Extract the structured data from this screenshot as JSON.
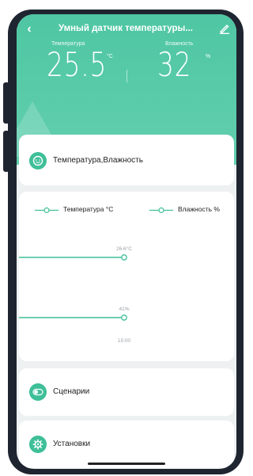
{
  "app": {
    "title": "Умный датчик температуры...",
    "back_icon": "chevron-left-icon",
    "edit_icon": "pencil-icon"
  },
  "readings": {
    "temperature": {
      "label": "Температура",
      "value": "25.5",
      "unit": "°C"
    },
    "humidity": {
      "label": "Влажность",
      "value": "32",
      "unit": "%"
    }
  },
  "cards": {
    "temp_humidity": {
      "label": "Температура,Влажность",
      "icon": "smiley-face-icon"
    },
    "scenarios": {
      "label": "Сценарии",
      "icon": "toggle-icon"
    },
    "settings": {
      "label": "Установки",
      "icon": "gear-icon"
    }
  },
  "colors": {
    "accent": "#3fbf98",
    "header": "#55c8a6",
    "background": "#eef1f2"
  },
  "chart_data": {
    "type": "line",
    "legend": [
      "Температура °C",
      "Влажность %"
    ],
    "legend_placement": "top-left",
    "x": [
      "15:00"
    ],
    "series": [
      {
        "name": "Температура °C",
        "values": [
          26.6
        ],
        "point_label": "26.6°C"
      },
      {
        "name": "Влажность %",
        "values": [
          41
        ],
        "point_label": "41%"
      }
    ],
    "xtick_labels": [
      "15:00"
    ],
    "grid": false
  }
}
